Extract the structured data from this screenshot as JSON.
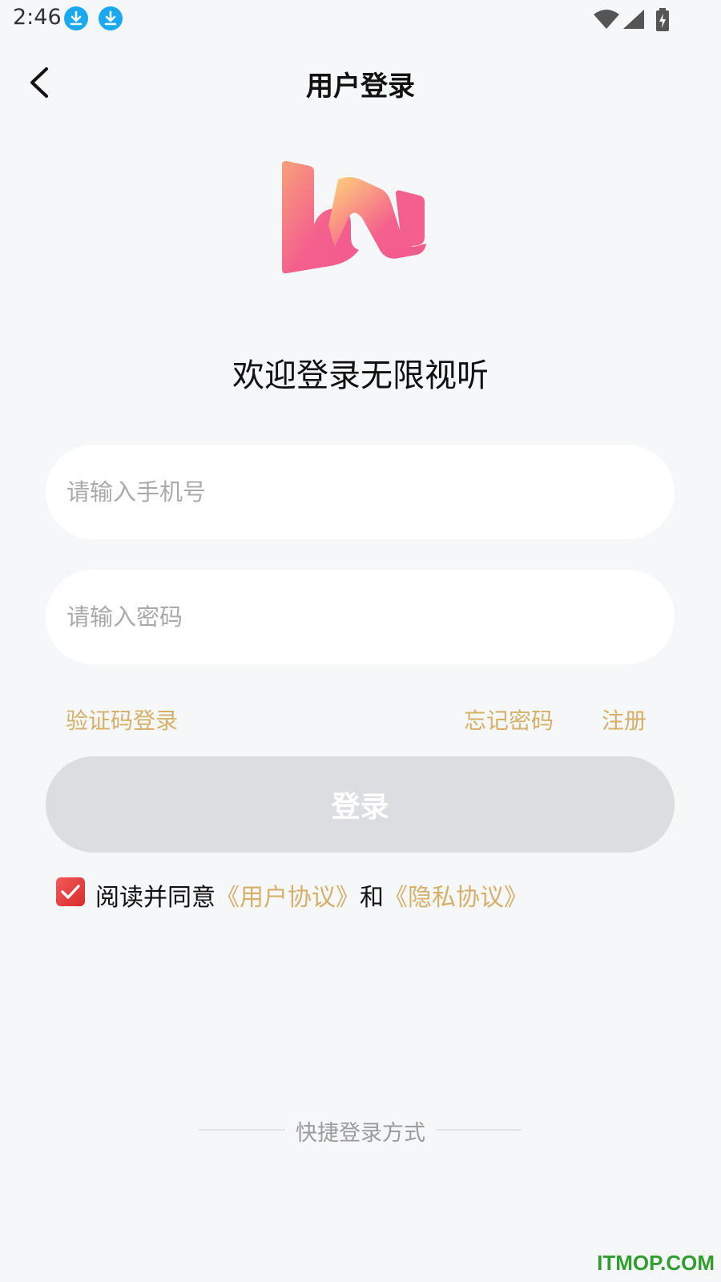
{
  "status_bar": {
    "time": "2:46",
    "notification_icons": [
      "download-icon",
      "download-icon"
    ],
    "system_icons": [
      "wifi-icon",
      "signal-icon",
      "battery-charging-icon"
    ]
  },
  "header": {
    "back_icon": "chevron-left-icon",
    "title": "用户登录"
  },
  "logo": {
    "icon": "app-logo"
  },
  "welcome": "欢迎登录无限视听",
  "form": {
    "phone_placeholder": "请输入手机号",
    "password_placeholder": "请输入密码",
    "sms_login": "验证码登录",
    "forgot_password": "忘记密码",
    "register": "注册",
    "login_button": "登录"
  },
  "agreement": {
    "checked": true,
    "prefix": "阅读并同意",
    "user_agreement": "《用户协议》",
    "conjunction": "和",
    "privacy_agreement": "《隐私协议》"
  },
  "quick_login": {
    "title": "快捷登录方式"
  },
  "watermark": "ITMOP.COM",
  "colors": {
    "accent_gold": "#d5b06a",
    "button_disabled": "#dcdde1",
    "checkbox_red": "#e03a3a",
    "background": "#f6f7f9"
  }
}
